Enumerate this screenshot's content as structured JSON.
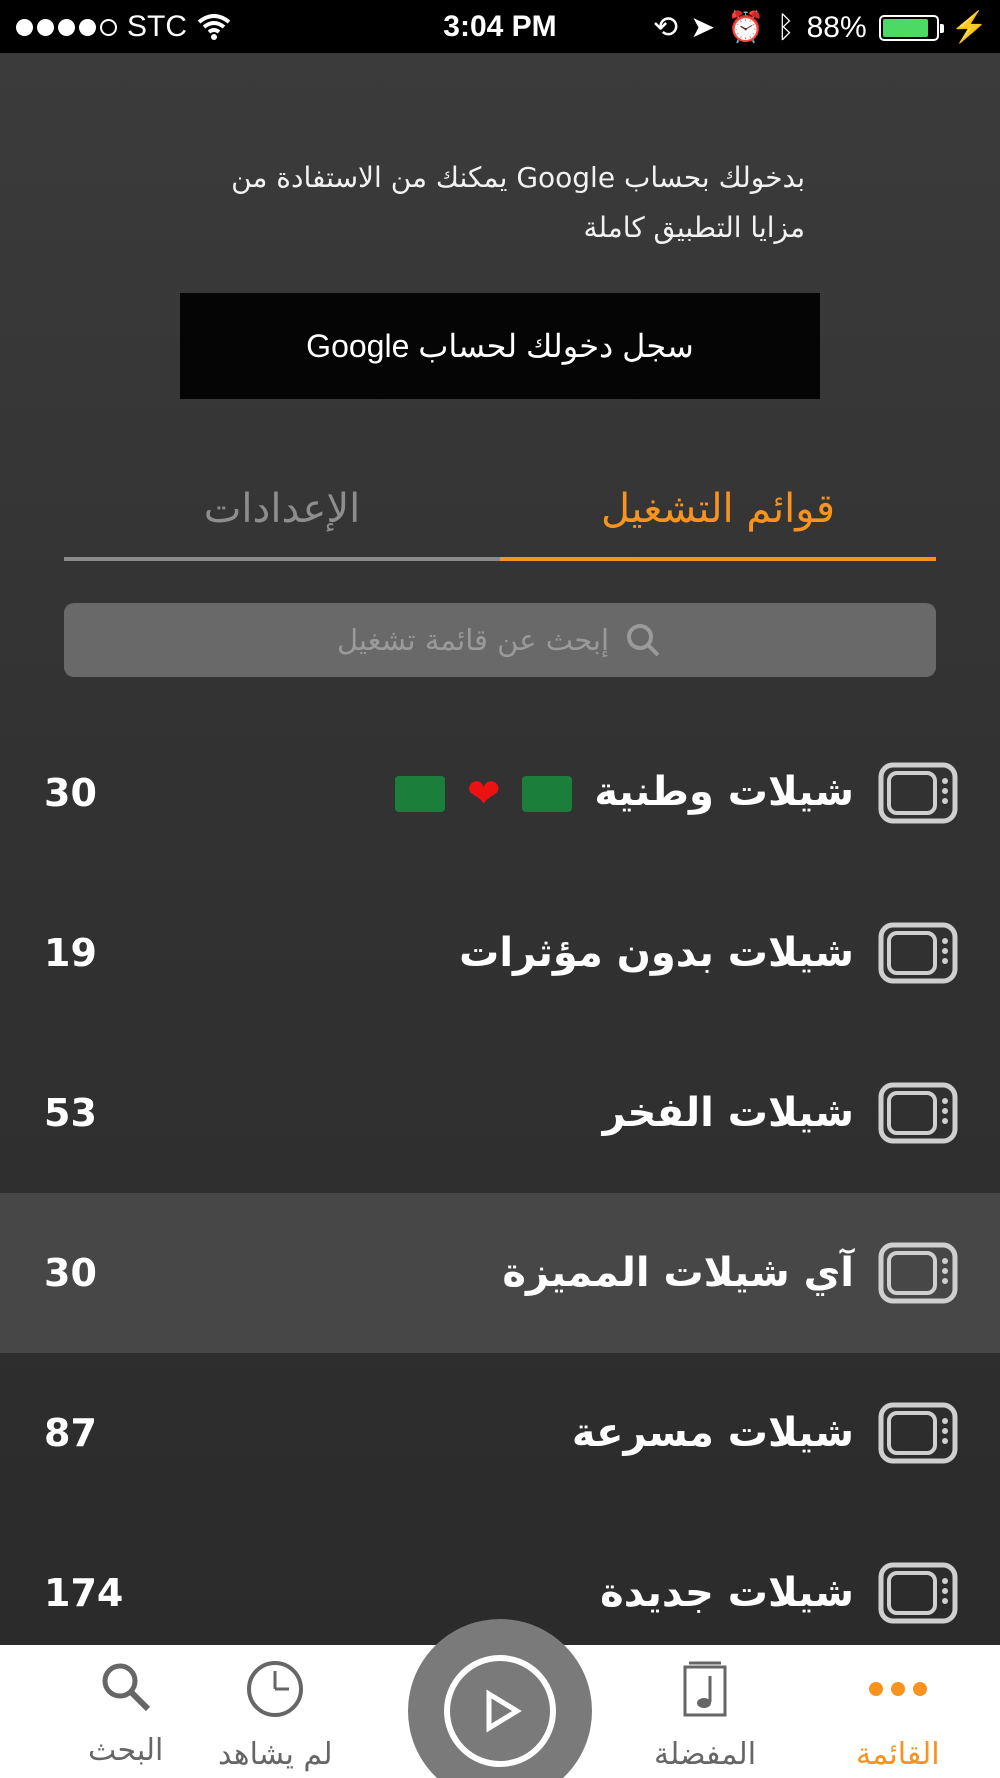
{
  "status_bar": {
    "carrier": "STC",
    "time": "3:04 PM",
    "battery": "88%",
    "battery_level": 0.88
  },
  "intro": {
    "text": "بدخولك بحساب Google يمكنك من الاستفادة من مزايا التطبيق كاملة"
  },
  "google_button": {
    "label": "سجل دخولك لحساب Google"
  },
  "tabs": [
    {
      "label": "قوائم التشغيل",
      "active": true
    },
    {
      "label": "الإعدادات",
      "active": false
    }
  ],
  "search": {
    "placeholder": "إبحث عن قائمة تشغيل"
  },
  "playlists": [
    {
      "title": "شيلات وطنية",
      "count": "30",
      "icon": "tv-icon",
      "decorations": [
        "saudi-flag",
        "heart",
        "saudi-flag"
      ]
    },
    {
      "title": "شيلات بدون مؤثرات",
      "count": "19",
      "icon": "tv-icon"
    },
    {
      "title": "شيلات الفخر",
      "count": "53",
      "icon": "tv-icon"
    },
    {
      "title": "آي شيلات المميزة",
      "count": "30",
      "icon": "tv-icon",
      "highlighted": true
    },
    {
      "title": "شيلات مسرعة",
      "count": "87",
      "icon": "tv-icon"
    },
    {
      "title": "شيلات جديدة",
      "count": "174",
      "icon": "tv-icon"
    }
  ],
  "tabbar": {
    "items": [
      {
        "label": "البحث",
        "icon": "search-icon"
      },
      {
        "label": "لم يشاهد",
        "icon": "clock-icon"
      },
      {
        "label": "المفضلة",
        "icon": "music-note-icon"
      },
      {
        "label": "القائمة",
        "icon": "more-dots-icon",
        "active": true
      }
    ],
    "play_icon": "play-icon"
  },
  "colors": {
    "accent": "#f7931e",
    "background": "#2d2d2d",
    "highlight": "#474747"
  }
}
